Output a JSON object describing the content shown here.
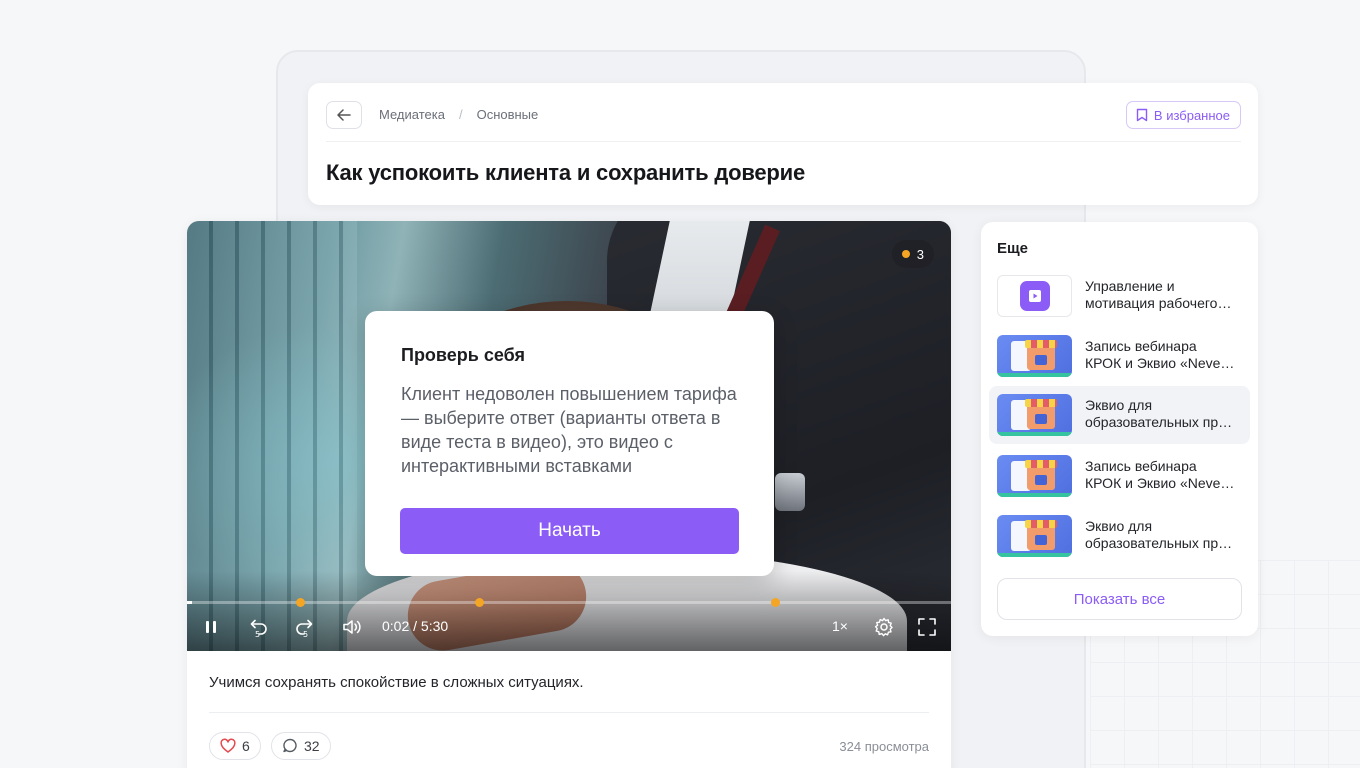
{
  "header": {
    "back_icon": "arrow-left-icon",
    "breadcrumb": [
      "Медиатека",
      "Основные"
    ],
    "breadcrumb_separator": "/",
    "favorite_label": "В избранное",
    "title": "Как успокоить клиента и сохранить доверие"
  },
  "player": {
    "marker_count": "3",
    "marker_color": "#f5a524",
    "quiz": {
      "title": "Проверь себя",
      "text": "Клиент недоволен повышением тарифа — выберите ответ (варианты ответа в виде теста в видео), это видео с интерактивными вставками",
      "button": "Начать"
    },
    "time": "0:02 / 5:30",
    "speed": "1×",
    "progress_fraction": 0.006
  },
  "description": "Учимся сохранять спокойствие в сложных ситуациях.",
  "stats": {
    "likes": "6",
    "comments": "32",
    "views": "324 просмотра"
  },
  "sidebar": {
    "title": "Еще",
    "items": [
      {
        "line1": "Управление и",
        "line2": "мотивация рабочего…",
        "thumb": "play-icon"
      },
      {
        "line1": "Запись вебинара",
        "line2": "КРОК и Эквио «Neve…",
        "thumb": "shop-illustration"
      },
      {
        "line1": "Эквио для",
        "line2": "образовательных пр…",
        "thumb": "shop-illustration"
      },
      {
        "line1": "Запись вебинара",
        "line2": "КРОК и Эквио «Neve…",
        "thumb": "shop-illustration"
      },
      {
        "line1": "Эквио для",
        "line2": "образовательных пр…",
        "thumb": "shop-illustration"
      }
    ],
    "active_index": 2,
    "show_all": "Показать все"
  },
  "colors": {
    "accent": "#8b5cf6",
    "marker": "#f5a524"
  }
}
